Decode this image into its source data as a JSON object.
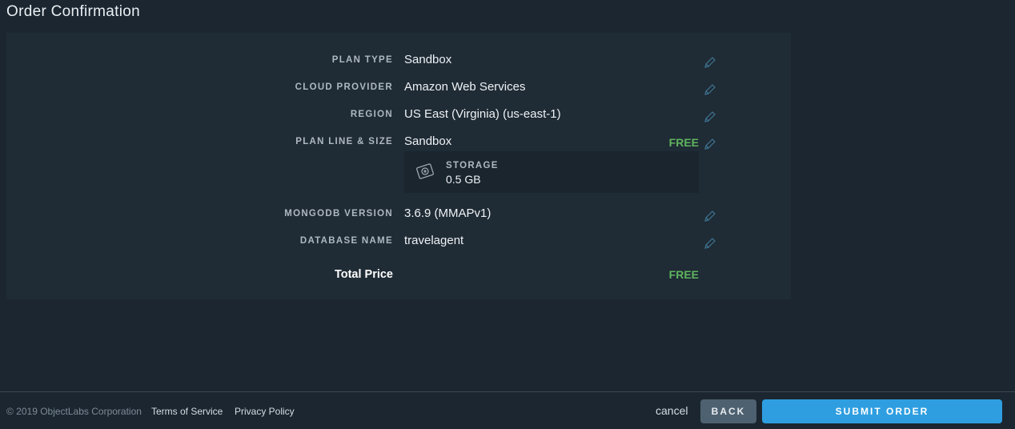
{
  "page": {
    "title": "Order Confirmation"
  },
  "summary": {
    "plan_type": {
      "label": "PLAN TYPE",
      "value": "Sandbox"
    },
    "cloud_provider": {
      "label": "CLOUD PROVIDER",
      "value": "Amazon Web Services"
    },
    "region": {
      "label": "REGION",
      "value": "US East (Virginia) (us-east-1)"
    },
    "plan_line": {
      "label": "PLAN LINE & SIZE",
      "value": "Sandbox",
      "price": "FREE"
    },
    "storage": {
      "label": "STORAGE",
      "value": "0.5 GB",
      "icon": "disk-icon"
    },
    "mongodb_version": {
      "label": "MONGODB VERSION",
      "value": "3.6.9 (MMAPv1)"
    },
    "database_name": {
      "label": "DATABASE NAME",
      "value": "travelagent"
    },
    "total": {
      "label": "Total Price",
      "value": "FREE"
    }
  },
  "footer": {
    "copyright": "© 2019 ObjectLabs Corporation",
    "terms": "Terms of Service",
    "privacy": "Privacy Policy",
    "cancel": "cancel",
    "back": "BACK",
    "submit": "SUBMIT ORDER"
  },
  "colors": {
    "background": "#1b2630",
    "panel": "#1f2b35",
    "free": "#5fb55e",
    "submit": "#2e9ee0",
    "back": "#4e6170",
    "edit_icon": "#3d6f8c"
  }
}
